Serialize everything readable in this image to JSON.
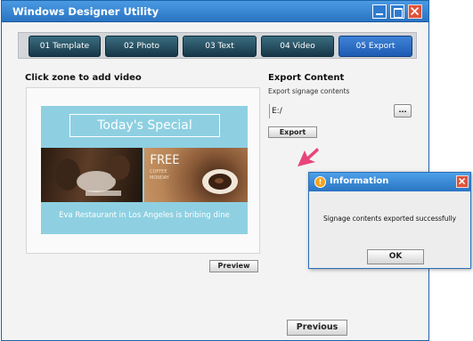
{
  "window": {
    "title": "Windows Designer Utility"
  },
  "tabs": [
    {
      "label": "01 Template",
      "active": false
    },
    {
      "label": "02 Photo",
      "active": false
    },
    {
      "label": "03 Text",
      "active": false
    },
    {
      "label": "04 Video",
      "active": false
    },
    {
      "label": "05 Export",
      "active": true
    }
  ],
  "video_zone": {
    "heading": "Click zone to add video",
    "poster_title": "Today's Special",
    "poster_free": "FREE",
    "poster_free_sub": "COFFEE MONDAY",
    "poster_caption": "Eva Restaurant in Los Angeles is bribing dine",
    "preview_label": "Preview"
  },
  "export": {
    "heading": "Export Content",
    "subheading": "Export signage contents",
    "path_value": "E:/",
    "browse_label": "...",
    "export_label": "Export"
  },
  "navigation": {
    "previous_label": "Previous"
  },
  "dialog": {
    "title": "Information",
    "message": "Signage contents exported successfully",
    "ok_label": "OK",
    "icon": "info-icon"
  },
  "colors": {
    "titlebar": "#2a74c3",
    "tab_active": "#1d5bb3",
    "tab_inactive": "#163748",
    "poster_background": "#8ed0e2",
    "arrow": "#e8457a",
    "close_button": "#e0533b"
  }
}
